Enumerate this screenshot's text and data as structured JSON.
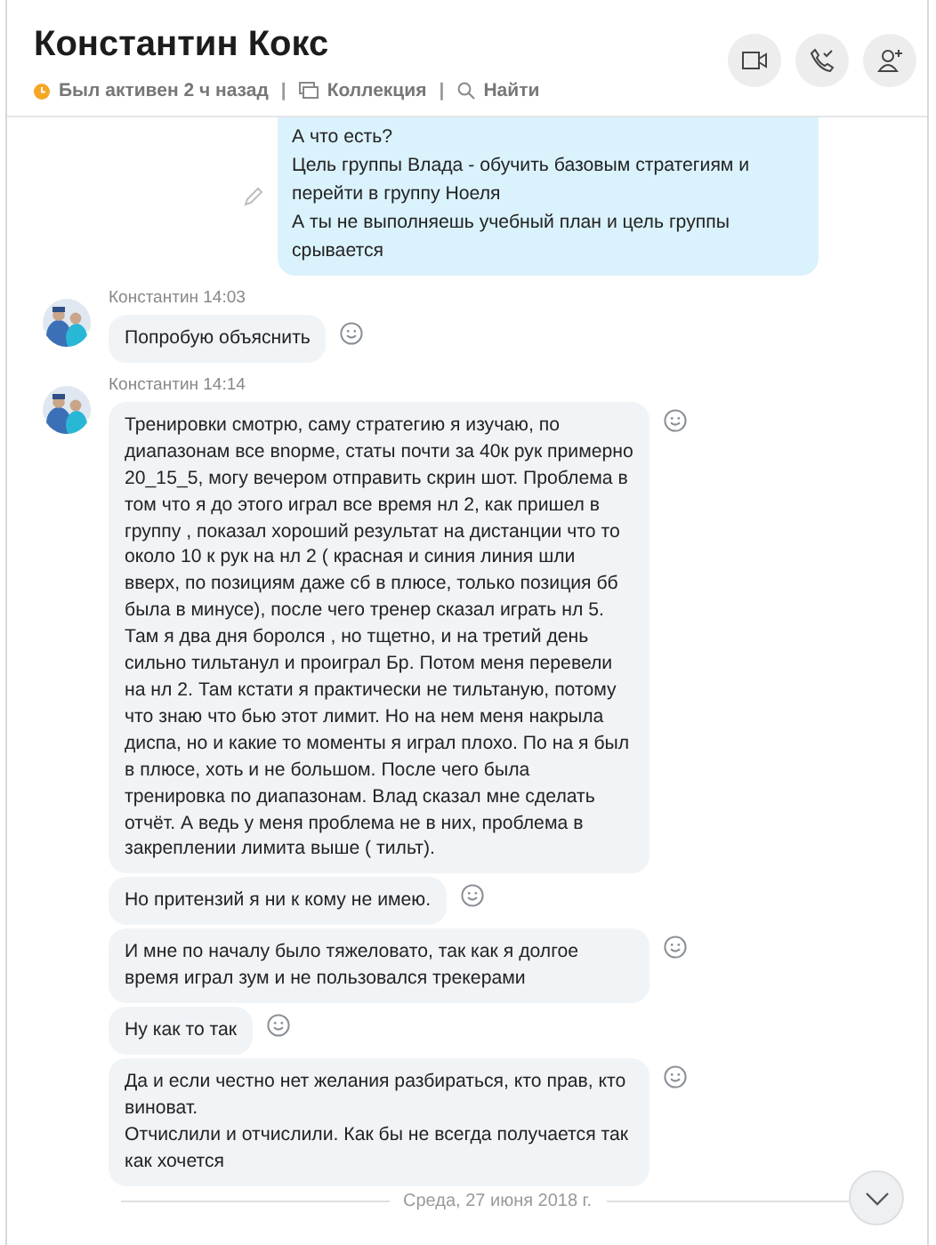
{
  "header": {
    "title": "Константин Кокс",
    "status": "Был активен 2 ч назад",
    "separator": "|",
    "links": [
      "Коллекция",
      "Найти"
    ]
  },
  "feed": [
    {
      "kind": "outgoing",
      "text": "А что есть?\nЦель группы Влада -  обучить базовым стратегиям и перейти в группу Ноеля\nА ты не выполняешь учебный план и цель группы срывается"
    },
    {
      "kind": "group",
      "sender": "Константин",
      "time": "14:03",
      "bubbles": [
        "Попробую объяснить"
      ]
    },
    {
      "kind": "group",
      "sender": "Константин",
      "time": "14:14",
      "bubbles": [
        "Тренировки смотрю, саму стратегию я изучаю, по диапазонам все вnорме, статы почти за 40к рук примерно 20_15_5, могу вечером отправить скрин шот. Проблема в том что я до этого играл все время нл 2, как пришел в группу , показал хороший результат на дистанции что то около 10 к рук на нл 2 ( красная и синия линия шли вверх, по позициям даже сб в плюсе, только позиция бб была в минусе), после чего тренер сказал играть нл 5.\nТам я два дня боролся , но тщетно, и на третий день сильно тильтанул и проиграл Бр. Потом меня перевели на нл 2. Там кстати я практически не тильтаную, потому что знаю что бью этот лимит. Но на нем меня накрыла диспа, но и какие то моменты я играл плохо. По на я был в плюсе, хоть и не большом. После чего была тренировка по диапазонам. Влад сказал мне сделать отчёт. А ведь у меня проблема не в них, проблема в закреплении лимита выше ( тильт).",
        "Но притензий я ни к кому не имею.",
        "И мне по началу было тяжеловато, так как я долгое время играл зум и не пользовался трекерами",
        "Ну как то так",
        "Да и если честно нет желания разбираться, кто прав, кто виноват.\nОтчислили и отчислили. Как бы не всегда получается так как хочется"
      ]
    },
    {
      "kind": "date",
      "text": "Среда, 27 июня 2018 г."
    }
  ]
}
